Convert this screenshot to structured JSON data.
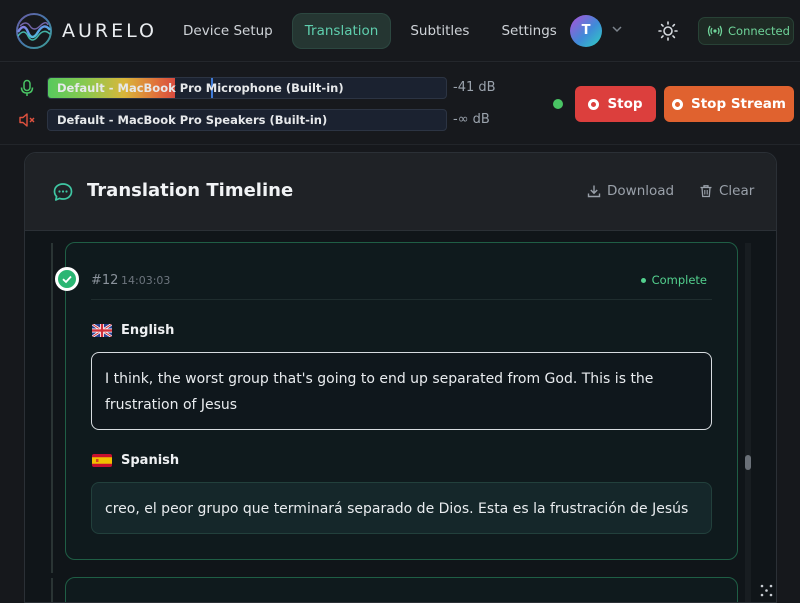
{
  "app": {
    "name": "AURELO"
  },
  "nav": {
    "items": [
      {
        "label": "Device Setup",
        "active": false
      },
      {
        "label": "Translation",
        "active": true
      },
      {
        "label": "Subtitles",
        "active": false
      },
      {
        "label": "Settings",
        "active": false
      }
    ]
  },
  "user": {
    "initial": "T"
  },
  "connection": {
    "label": "Connected",
    "color": "#6fd49a"
  },
  "devices": {
    "input": {
      "name": "Default - MacBook Pro Microphone (Built-in)",
      "level_db": "-41 dB",
      "level_fraction": 0.32,
      "peak_fraction": 0.41
    },
    "output": {
      "name": "Default - MacBook Pro Speakers (Built-in)",
      "level_db": "-∞ dB",
      "level_fraction": 0
    }
  },
  "controls": {
    "stop_label": "Stop",
    "stop_stream_label": "Stop Stream"
  },
  "timeline": {
    "title": "Translation Timeline",
    "download_label": "Download",
    "clear_label": "Clear",
    "entries": [
      {
        "number": "#12",
        "time": "14:03:03",
        "status": "Complete",
        "source": {
          "language": "English",
          "text": "I think, the worst group that's going to end up separated from God. This is the frustration of Jesus"
        },
        "target": {
          "language": "Spanish",
          "text": "creo, el peor grupo que terminará separado de Dios. Esta es la frustración de Jesús"
        }
      }
    ]
  },
  "colors": {
    "accent": "#5fcfae",
    "stop": "#dc3f3d",
    "stop_stream": "#e0622f",
    "complete": "#53d08e"
  }
}
